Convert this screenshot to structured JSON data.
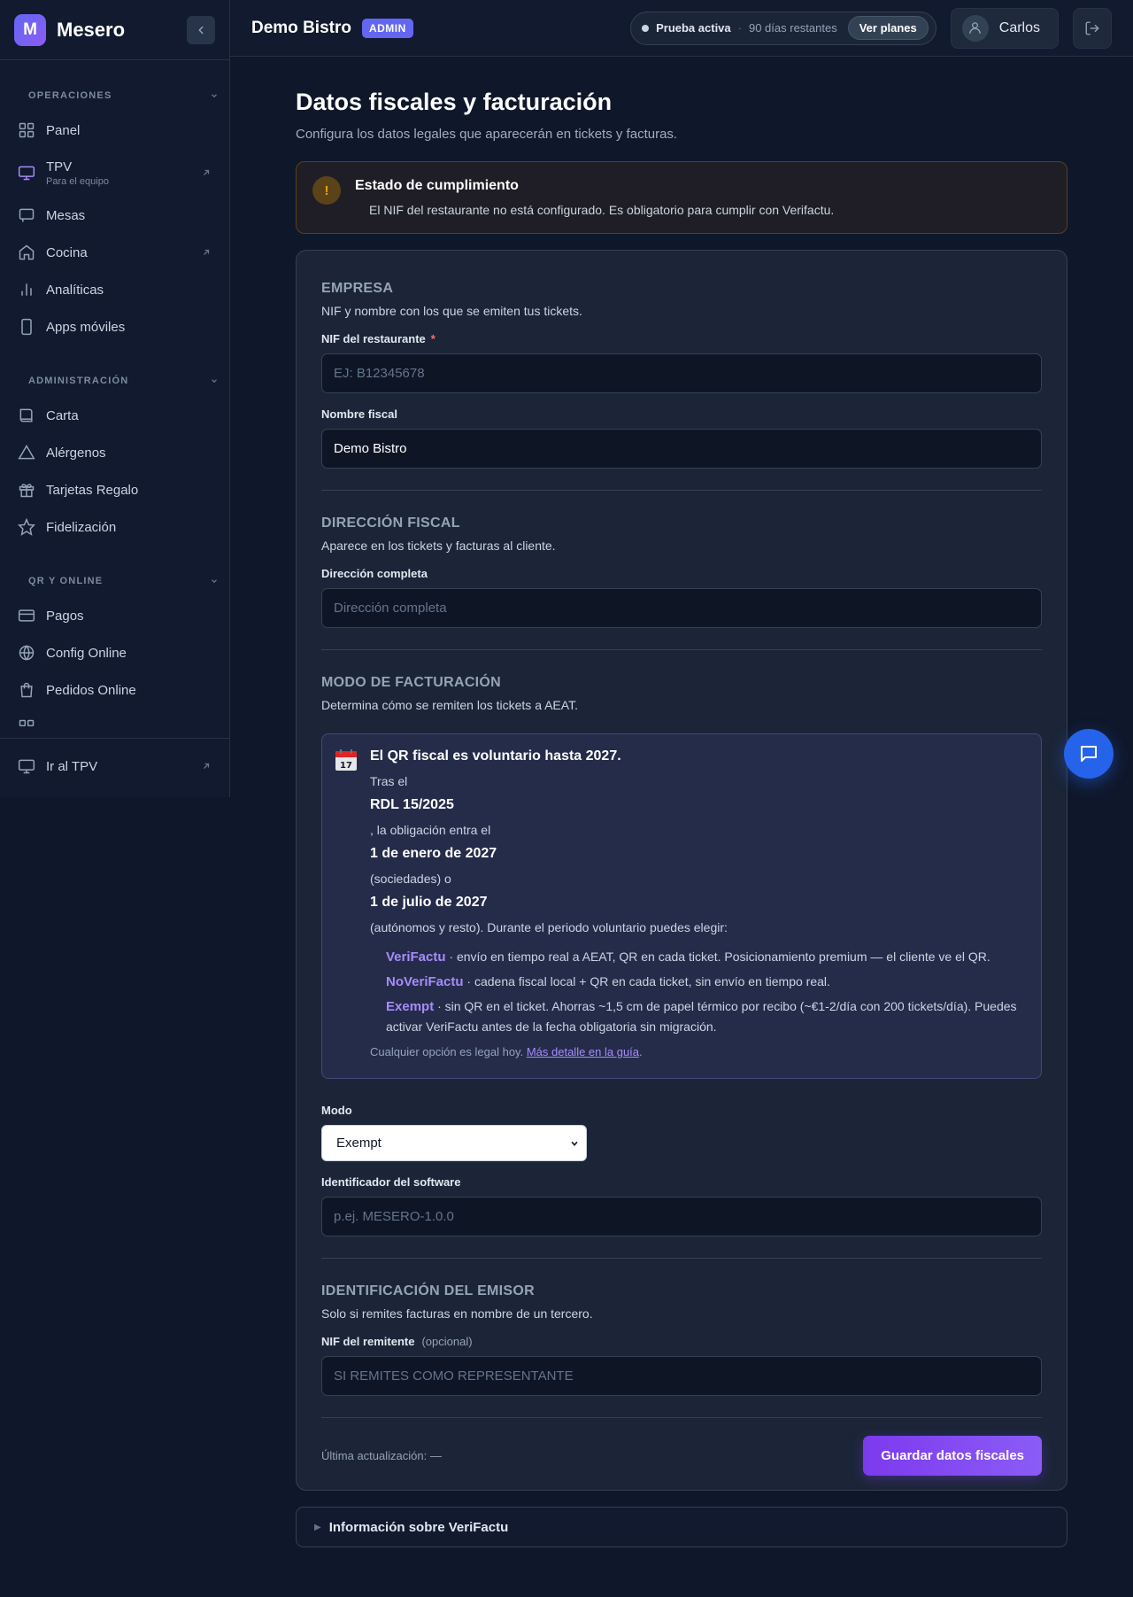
{
  "brand": {
    "logo_letter": "M",
    "name": "Mesero"
  },
  "sidebar": {
    "sections": [
      {
        "title": "OPERACIONES",
        "items": [
          {
            "label": "Panel",
            "icon": "grid-icon"
          },
          {
            "label": "TPV",
            "sub": "Para el equipo",
            "icon": "monitor-icon",
            "external": true
          },
          {
            "label": "Mesas",
            "icon": "table-icon"
          },
          {
            "label": "Cocina",
            "icon": "home-icon",
            "external": true
          },
          {
            "label": "Analíticas",
            "icon": "bar-chart-icon"
          },
          {
            "label": "Apps móviles",
            "icon": "smartphone-icon"
          }
        ]
      },
      {
        "title": "ADMINISTRACIÓN",
        "items": [
          {
            "label": "Carta",
            "icon": "book-icon"
          },
          {
            "label": "Alérgenos",
            "icon": "warning-triangle-icon"
          },
          {
            "label": "Tarjetas Regalo",
            "icon": "gift-icon"
          },
          {
            "label": "Fidelización",
            "icon": "star-icon"
          }
        ]
      },
      {
        "title": "QR Y ONLINE",
        "items": [
          {
            "label": "Pagos",
            "icon": "credit-card-icon"
          },
          {
            "label": "Config Online",
            "icon": "globe-icon"
          },
          {
            "label": "Pedidos Online",
            "icon": "shopping-bag-icon"
          }
        ]
      }
    ],
    "footer_item": {
      "label": "Ir al TPV",
      "icon": "monitor-icon"
    }
  },
  "topbar": {
    "business_name": "Demo Bistro",
    "role_badge": "ADMIN",
    "trial_status": "Prueba activa",
    "trial_separator": "·",
    "trial_days": "90 días restantes",
    "plans_button": "Ver planes",
    "user_name": "Carlos"
  },
  "page": {
    "title": "Datos fiscales y facturación",
    "subtitle": "Configura los datos legales que aparecerán en tickets y facturas."
  },
  "alert": {
    "icon_glyph": "!",
    "title": "Estado de cumplimiento",
    "message": "El NIF del restaurante no está configurado. Es obligatorio para cumplir con Verifactu."
  },
  "empresa": {
    "title": "EMPRESA",
    "description": "NIF y nombre con los que se emiten tus tickets.",
    "nif_label": "NIF del restaurante",
    "required_mark": "*",
    "nif_placeholder": "EJ: B12345678",
    "nombre_label": "Nombre fiscal",
    "nombre_value": "Demo Bistro"
  },
  "direccion": {
    "title": "DIRECCIÓN FISCAL",
    "description": "Aparece en los tickets y facturas al cliente.",
    "label": "Dirección completa",
    "placeholder": "Dirección completa"
  },
  "facturacion": {
    "title": "MODO DE FACTURACIÓN",
    "description": "Determina cómo se remiten los tickets a AEAT.",
    "info": {
      "icon": "calendar-icon",
      "heading": "El QR fiscal es voluntario hasta 2027.",
      "line1": "Tras el",
      "strong1": "RDL 15/2025",
      "line2": ", la obligación entra el",
      "strong2": "1 de enero de 2027",
      "line3": "(sociedades) o",
      "strong3": "1 de julio de 2027",
      "line4": "(autónomos y resto). Durante el periodo voluntario puedes elegir:",
      "options": [
        {
          "name": "VeriFactu",
          "text": " · envío en tiempo real a AEAT, QR en cada ticket. Posicionamiento premium — el cliente ve el QR."
        },
        {
          "name": "NoVeriFactu",
          "text": " · cadena fiscal local + QR en cada ticket, sin envío en tiempo real."
        },
        {
          "name": "Exempt",
          "text": " · sin QR en el ticket. Ahorras ~1,5 cm de papel térmico por recibo (~€1-2/día con 200 tickets/día). Puedes activar VeriFactu antes de la fecha obligatoria sin migración."
        }
      ],
      "note": "Cualquier opción es legal hoy.",
      "note_link": "Más detalle en la guía",
      "note_end": "."
    },
    "mode_label": "Modo",
    "mode_value": "Exempt",
    "software_label": "Identificador del software",
    "software_placeholder": "p.ej. MESERO-1.0.0"
  },
  "emisor": {
    "title": "IDENTIFICACIÓN DEL EMISOR",
    "description": "Solo si remites facturas en nombre de un tercero.",
    "label": "NIF del remitente",
    "optional": "(opcional)",
    "placeholder": "SI REMITES COMO REPRESENTANTE"
  },
  "footer": {
    "last_update": "Última actualización: —",
    "save_button": "Guardar datos fiscales"
  },
  "details": {
    "label": "Información sobre VeriFactu"
  },
  "colors": {
    "background": "#0f172a",
    "accent": "#8b5cf6",
    "warning": "#f59e0b",
    "fab": "#2563eb"
  }
}
